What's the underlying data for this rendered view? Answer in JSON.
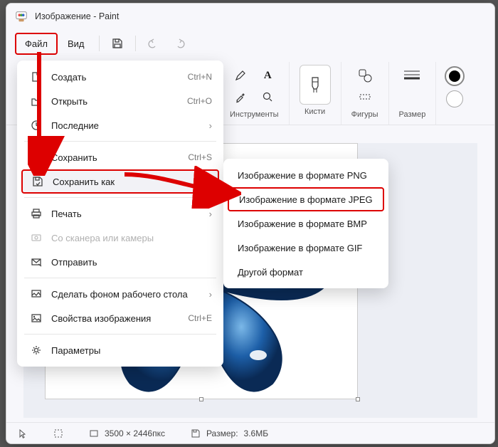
{
  "titlebar": {
    "title": "Изображение - Paint"
  },
  "menubar": {
    "file": "Файл",
    "view": "Вид"
  },
  "fileMenu": {
    "items": [
      {
        "icon": "new",
        "label": "Создать",
        "shortcut": "Ctrl+N",
        "sub": false
      },
      {
        "icon": "open",
        "label": "Открыть",
        "shortcut": "Ctrl+O",
        "sub": false
      },
      {
        "icon": "recent",
        "label": "Последние",
        "shortcut": "",
        "sub": true
      },
      {
        "sep": true
      },
      {
        "icon": "save",
        "label": "Сохранить",
        "shortcut": "Ctrl+S",
        "sub": false
      },
      {
        "icon": "saveas",
        "label": "Сохранить как",
        "shortcut": "",
        "sub": true,
        "hl": true
      },
      {
        "sep": true
      },
      {
        "icon": "print",
        "label": "Печать",
        "shortcut": "",
        "sub": true
      },
      {
        "icon": "scanner",
        "label": "Со сканера или камеры",
        "shortcut": "",
        "sub": false,
        "disabled": true
      },
      {
        "icon": "send",
        "label": "Отправить",
        "shortcut": "",
        "sub": false
      },
      {
        "sep": true
      },
      {
        "icon": "wallpaper",
        "label": "Сделать фоном рабочего стола",
        "shortcut": "",
        "sub": true
      },
      {
        "icon": "props",
        "label": "Свойства изображения",
        "shortcut": "Ctrl+E",
        "sub": false
      },
      {
        "sep": true
      },
      {
        "icon": "settings",
        "label": "Параметры",
        "shortcut": "",
        "sub": false
      }
    ]
  },
  "saveAsSub": {
    "items": [
      {
        "label": "Изображение в формате PNG"
      },
      {
        "label": "Изображение в формате JPEG",
        "hl": true
      },
      {
        "label": "Изображение в формате BMP"
      },
      {
        "label": "Изображение в формате GIF"
      },
      {
        "label": "Другой формат"
      }
    ]
  },
  "ribbon": {
    "tools": "Инструменты",
    "brushes": "Кисти",
    "shapes": "Фигуры",
    "size": "Размер"
  },
  "statusbar": {
    "dims": "3500 × 2446пкс",
    "fsize_label": "Размер:",
    "fsize": "3.6МБ"
  }
}
